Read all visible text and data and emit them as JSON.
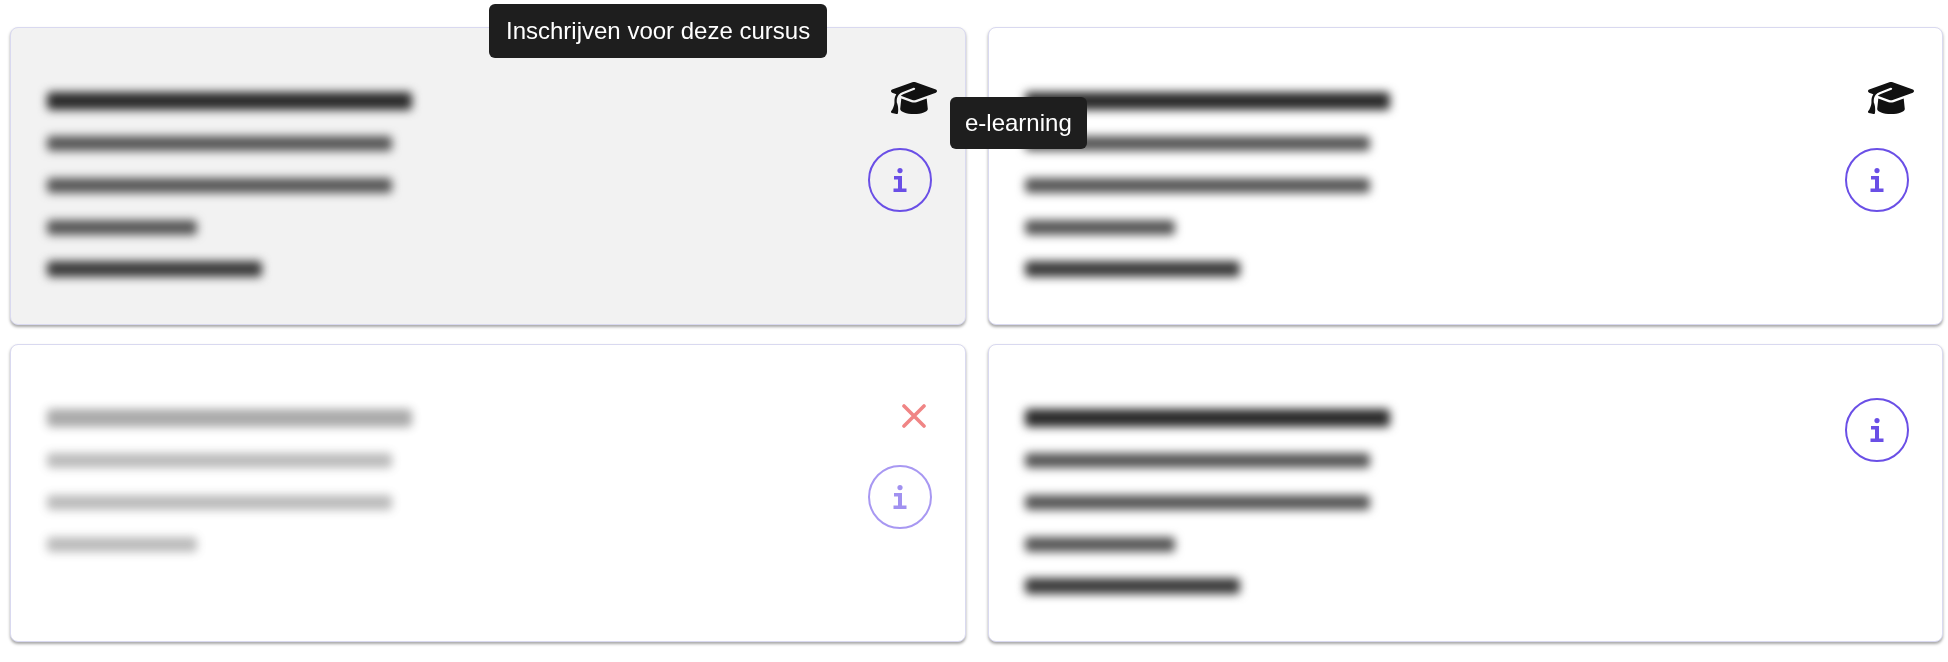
{
  "cards": [
    {
      "hovered": true,
      "disabled": false,
      "e_learning": true,
      "cancelled": false,
      "lines": [
        {
          "kind": "title"
        },
        {
          "kind": "code"
        },
        {
          "kind": "date"
        },
        {
          "kind": "type"
        },
        {
          "kind": "count"
        }
      ]
    },
    {
      "hovered": false,
      "disabled": false,
      "e_learning": true,
      "cancelled": false,
      "lines": [
        {
          "kind": "title"
        },
        {
          "kind": "code"
        },
        {
          "kind": "date"
        },
        {
          "kind": "type"
        },
        {
          "kind": "count"
        }
      ]
    },
    {
      "hovered": false,
      "disabled": true,
      "e_learning": false,
      "cancelled": true,
      "lines": [
        {
          "kind": "title"
        },
        {
          "kind": "code"
        },
        {
          "kind": "date"
        },
        {
          "kind": "type"
        }
      ]
    },
    {
      "hovered": false,
      "disabled": false,
      "e_learning": false,
      "cancelled": false,
      "lines": [
        {
          "kind": "title"
        },
        {
          "kind": "code"
        },
        {
          "kind": "date"
        },
        {
          "kind": "type"
        },
        {
          "kind": "count"
        }
      ]
    }
  ],
  "tooltips": [
    {
      "kind": "card",
      "text": "Inschrijven voor deze cursus"
    },
    {
      "kind": "icon",
      "text": "e-learning"
    }
  ]
}
